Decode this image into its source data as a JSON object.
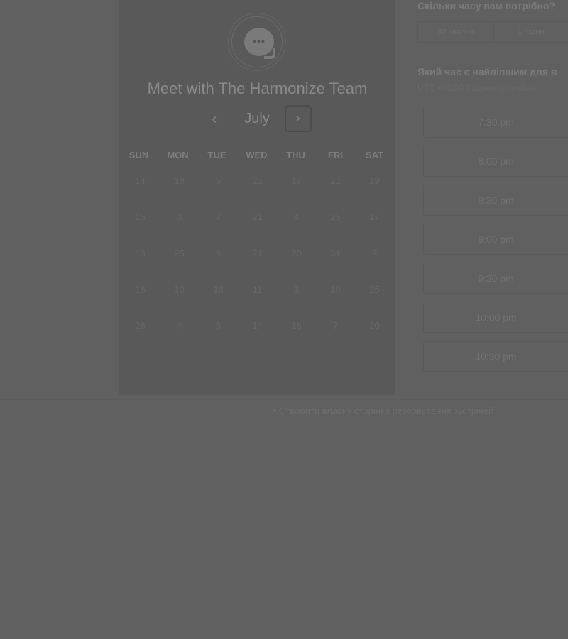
{
  "calendar": {
    "title": "Meet with The Harmonize Team",
    "month": "July",
    "prev_label": "‹",
    "next_label": "›",
    "days_of_week": [
      "SUN",
      "MON",
      "TUE",
      "WED",
      "THU",
      "FRI",
      "SAT"
    ],
    "weeks": [
      [
        "14",
        "18",
        "5",
        "22",
        "17",
        "22",
        "19"
      ],
      [
        "15",
        "3",
        "7",
        "21",
        "4",
        "25",
        "17"
      ],
      [
        "13",
        "25",
        "9",
        "21",
        "20",
        "31",
        "9"
      ],
      [
        "16",
        "10",
        "16",
        "11",
        "3",
        "10",
        "25"
      ],
      [
        "28",
        "4",
        "5",
        "14",
        "16",
        "7",
        "20"
      ]
    ]
  },
  "booking": {
    "duration_question": "Скільки часу вам потрібно?",
    "duration_options": [
      "30 хвилин",
      "1 годин"
    ],
    "time_question": "Який час є найліпшим для в",
    "timezone": "UTC +03:00 Східноєвропейськ",
    "slots": [
      "7:30 pm",
      "8:00 pm",
      "8:30 pm",
      "9:00 pm",
      "9:30 pm",
      "10:00 pm",
      "10:30 pm"
    ]
  },
  "footer": {
    "link_icon": "link-icon",
    "link_text": "Створити власну сторінка резервування зустрічей"
  }
}
